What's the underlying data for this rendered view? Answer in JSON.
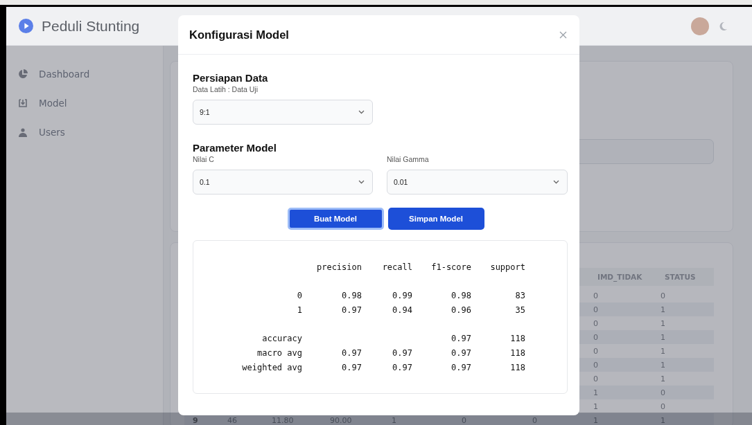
{
  "app": {
    "title": "Peduli Stunting"
  },
  "sidebar": {
    "items": [
      {
        "label": "Dashboard",
        "selected": false
      },
      {
        "label": "Model",
        "selected": false
      },
      {
        "label": "Users",
        "selected": false
      }
    ]
  },
  "table": {
    "columns": [
      {
        "label": "IMD_TIDAK"
      },
      {
        "label": "STATUS"
      }
    ],
    "rows": [
      {
        "cells": [
          "0",
          "0"
        ]
      },
      {
        "cells": [
          "0",
          "1"
        ]
      },
      {
        "cells": [
          "0",
          "1"
        ]
      },
      {
        "cells": [
          "0",
          "1"
        ]
      },
      {
        "cells": [
          "0",
          "1"
        ]
      },
      {
        "cells": [
          "0",
          "1"
        ]
      },
      {
        "cells": [
          "0",
          "1"
        ]
      },
      {
        "cells": [
          "1",
          "0"
        ]
      },
      {
        "cells": [
          "1",
          "0"
        ]
      },
      {
        "cells": [
          "9",
          "46",
          "11.80",
          "90.00",
          "1",
          "0",
          "0",
          "1",
          "1"
        ]
      }
    ]
  },
  "modal": {
    "title": "Konfigurasi Model",
    "sections": [
      {
        "title": "Persiapan Data",
        "fields": [
          {
            "label": "Data Latih : Data Uji",
            "value": "9:1"
          }
        ]
      },
      {
        "title": "Parameter Model",
        "fields": [
          {
            "label": "Nilai C",
            "value": "0.1"
          },
          {
            "label": "Nilai Gamma",
            "value": "0.01"
          }
        ]
      }
    ],
    "buttons": [
      {
        "label": "Buat Model",
        "focused": true
      },
      {
        "label": "Simpan Model",
        "focused": false
      }
    ],
    "report": {
      "columns": [
        "precision",
        "recall",
        "f1-score",
        "support"
      ],
      "groups": [
        [
          {
            "label": "0",
            "values": [
              "0.98",
              "0.99",
              "0.98",
              "83"
            ]
          },
          {
            "label": "1",
            "values": [
              "0.97",
              "0.94",
              "0.96",
              "35"
            ]
          }
        ],
        [
          {
            "label": "accuracy",
            "values": [
              "0.97",
              "118"
            ]
          },
          {
            "label": "macro avg",
            "values": [
              "0.97",
              "0.97",
              "0.97",
              "118"
            ]
          },
          {
            "label": "weighted avg",
            "values": [
              "0.97",
              "0.97",
              "0.97",
              "118"
            ]
          }
        ]
      ]
    }
  }
}
